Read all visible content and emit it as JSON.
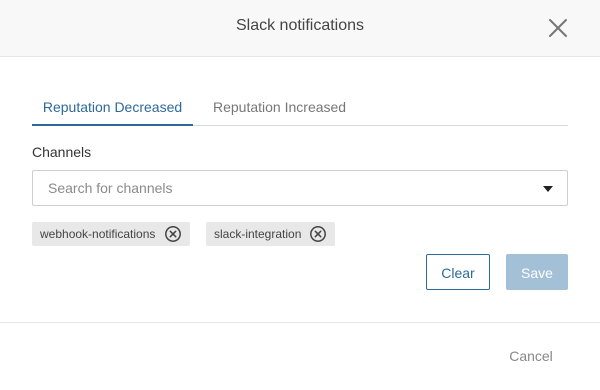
{
  "dialog": {
    "title": "Slack notifications",
    "close_icon": "close-icon"
  },
  "tabs": [
    {
      "label": "Reputation Decreased",
      "active": true
    },
    {
      "label": "Reputation Increased",
      "active": false
    }
  ],
  "channels": {
    "label": "Channels",
    "search_placeholder": "Search for channels",
    "search_value": "",
    "dropdown_icon": "caret-down-icon",
    "selected": [
      {
        "label": "webhook-notifications",
        "remove_icon": "circle-x-icon"
      },
      {
        "label": "slack-integration",
        "remove_icon": "circle-x-icon"
      }
    ]
  },
  "actions": {
    "clear_label": "Clear",
    "save_label": "Save"
  },
  "footer": {
    "cancel_label": "Cancel"
  },
  "colors": {
    "accent": "#2d6a97",
    "save_disabled": "#a4c0d6",
    "chip_bg": "#e8e8e8",
    "header_bg": "#f8f8f8"
  }
}
